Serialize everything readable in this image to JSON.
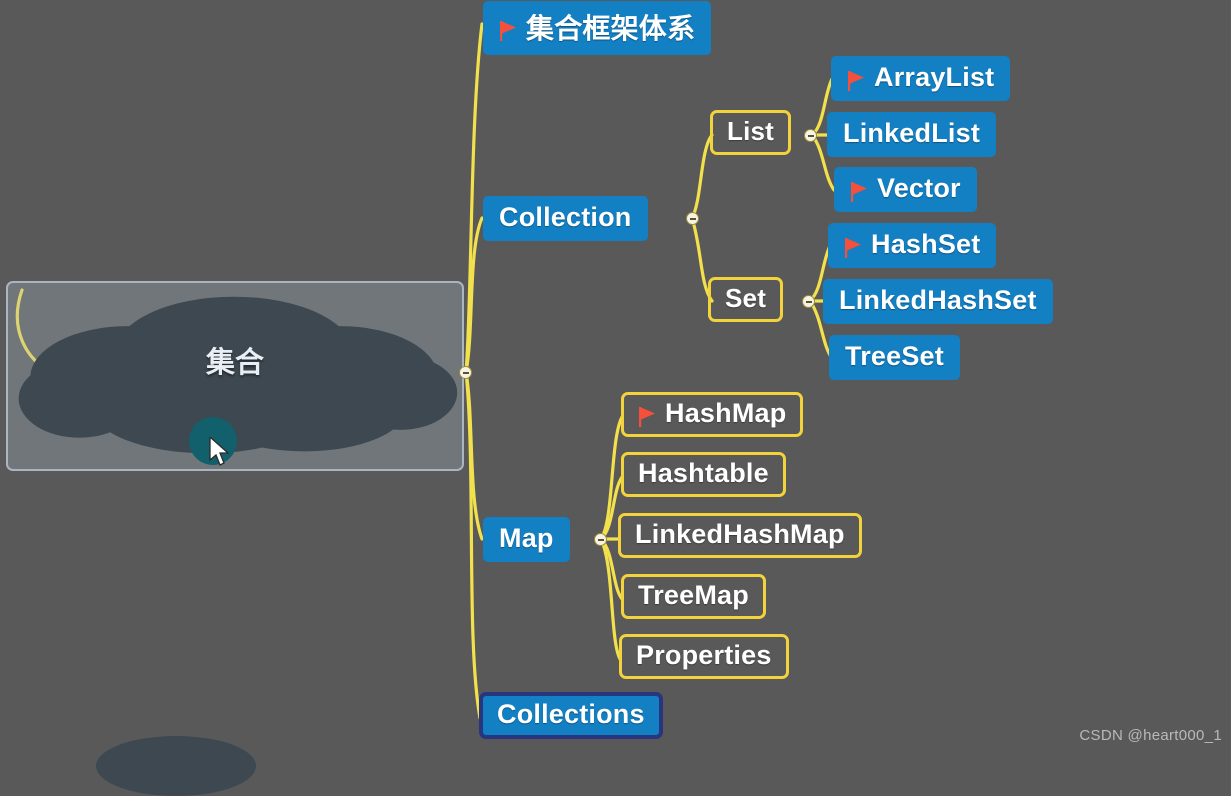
{
  "background_color": "#595959",
  "colors": {
    "node_fill": "#1380c4",
    "node_outline": "#f2d33c",
    "selected_border": "#27367f",
    "link": "#f2e04c",
    "flag": "#f4503c",
    "text": "#ffffff",
    "center_cloud": "#3d4850",
    "center_selection": "#a9b6c2",
    "teal_marker": "#12606b"
  },
  "center": {
    "label": "集合",
    "shape": "cloud",
    "selected": true,
    "collapse_dot": "minus"
  },
  "branches": [
    {
      "id": "framework",
      "label": "集合框架体系",
      "style": "fill",
      "flag": true
    },
    {
      "id": "collection",
      "label": "Collection",
      "style": "fill",
      "flag": false,
      "collapse_dot": "minus",
      "children": [
        {
          "id": "list",
          "label": "List",
          "style": "outline",
          "flag": false,
          "collapse_dot": "minus",
          "children": [
            {
              "id": "arraylist",
              "label": "ArrayList",
              "style": "fill",
              "flag": true
            },
            {
              "id": "linkedlist",
              "label": "LinkedList",
              "style": "fill",
              "flag": false
            },
            {
              "id": "vector",
              "label": "Vector",
              "style": "fill",
              "flag": true
            }
          ]
        },
        {
          "id": "set",
          "label": "Set",
          "style": "outline",
          "flag": false,
          "collapse_dot": "minus",
          "children": [
            {
              "id": "hashset",
              "label": "HashSet",
              "style": "fill",
              "flag": true
            },
            {
              "id": "linkedhashset",
              "label": "LinkedHashSet",
              "style": "fill",
              "flag": false
            },
            {
              "id": "treeset",
              "label": "TreeSet",
              "style": "fill",
              "flag": false
            }
          ]
        }
      ]
    },
    {
      "id": "map",
      "label": "Map",
      "style": "fill",
      "flag": false,
      "collapse_dot": "minus",
      "children": [
        {
          "id": "hashmap",
          "label": "HashMap",
          "style": "outline",
          "flag": true
        },
        {
          "id": "hashtable",
          "label": "Hashtable",
          "style": "outline",
          "flag": false
        },
        {
          "id": "linkedhashmap",
          "label": "LinkedHashMap",
          "style": "outline",
          "flag": false
        },
        {
          "id": "treemap",
          "label": "TreeMap",
          "style": "outline",
          "flag": false
        },
        {
          "id": "properties",
          "label": "Properties",
          "style": "outline",
          "flag": false
        }
      ]
    },
    {
      "id": "collections",
      "label": "Collections",
      "style": "selected",
      "flag": false
    }
  ],
  "watermark": "CSDN @heart000_1"
}
